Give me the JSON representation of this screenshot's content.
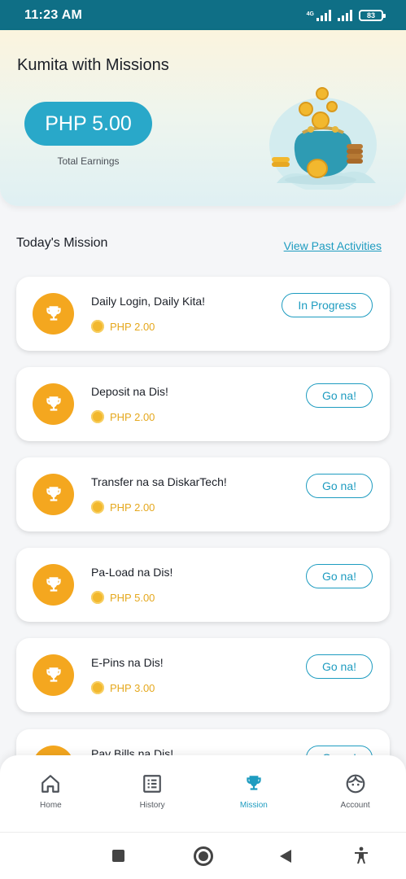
{
  "status_bar": {
    "time": "11:23 AM",
    "network": "4G",
    "battery": "83"
  },
  "header": {
    "title": "Kumita with Missions",
    "earnings_amount": "PHP 5.00",
    "earnings_caption": "Total Earnings"
  },
  "missions_section": {
    "title": "Today's Mission",
    "past_link": "View Past Activities"
  },
  "missions": [
    {
      "title": "Daily Login, Daily Kita!",
      "reward": "PHP 2.00",
      "action": "In Progress"
    },
    {
      "title": "Deposit na Dis!",
      "reward": "PHP 2.00",
      "action": "Go na!"
    },
    {
      "title": "Transfer na sa DiskarTech!",
      "reward": "PHP 2.00",
      "action": "Go na!"
    },
    {
      "title": "Pa-Load na Dis!",
      "reward": "PHP 5.00",
      "action": "Go na!"
    },
    {
      "title": "E-Pins na Dis!",
      "reward": "PHP 3.00",
      "action": "Go na!"
    },
    {
      "title": "Pay Bills na Dis!",
      "reward": "",
      "action": "Go na!"
    }
  ],
  "bottom_nav": {
    "items": [
      {
        "label": "Home",
        "icon": "home-icon"
      },
      {
        "label": "History",
        "icon": "list-icon"
      },
      {
        "label": "Mission",
        "icon": "trophy-icon",
        "active": true
      },
      {
        "label": "Account",
        "icon": "face-icon"
      }
    ]
  },
  "colors": {
    "accent": "#1e9cc0",
    "badge": "#f4a71f",
    "reward_text": "#e5a81e",
    "status_bar": "#0f6f86"
  }
}
